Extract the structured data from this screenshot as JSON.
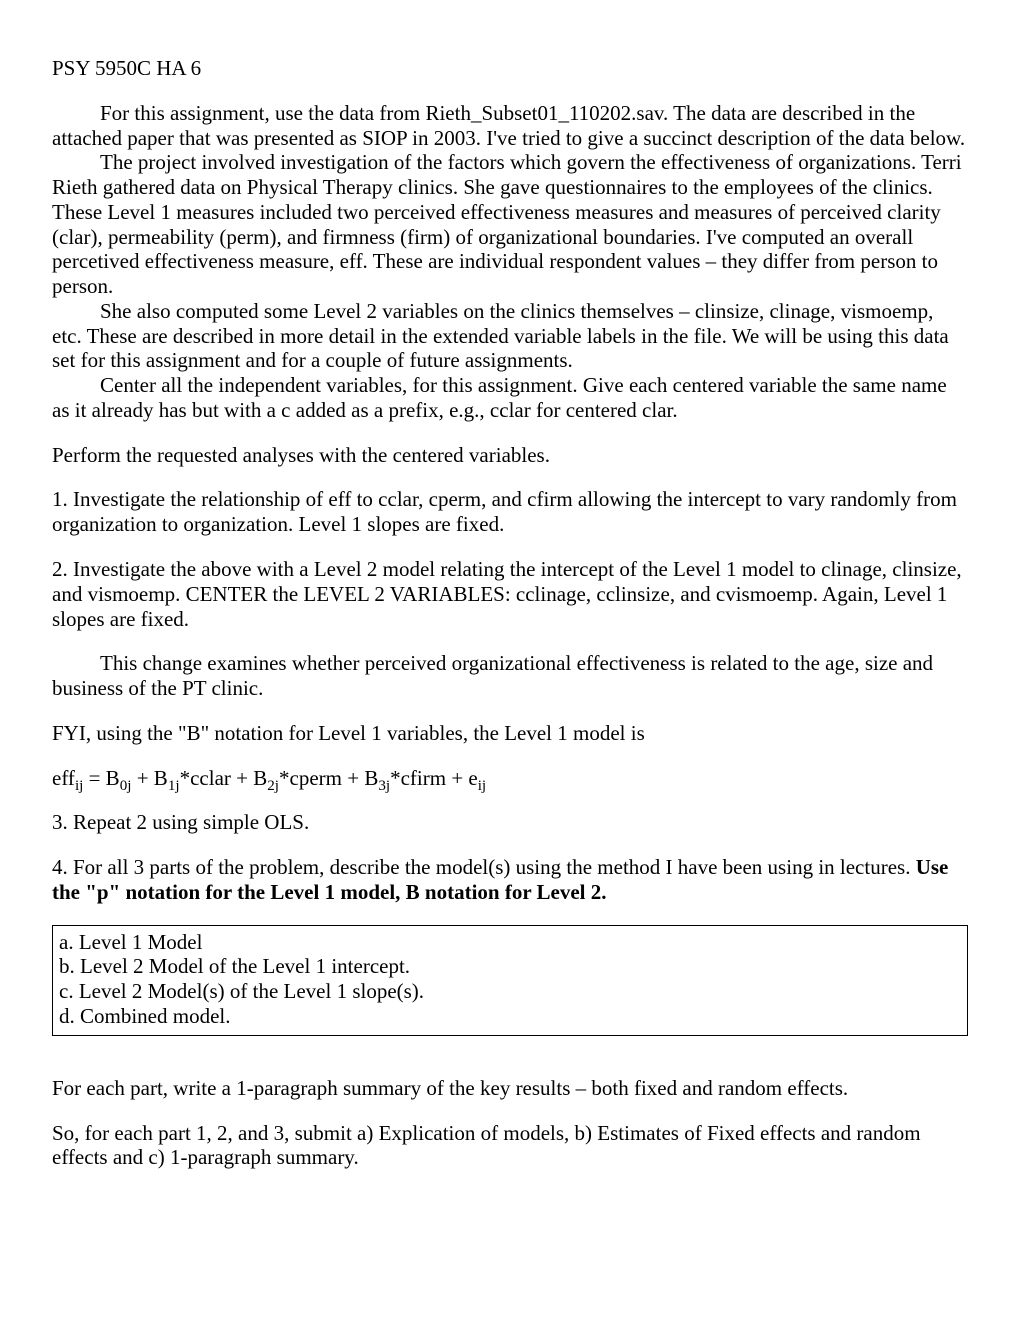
{
  "header": "PSY 5950C HA 6",
  "p1": "For this assignment, use the data from Rieth_Subset01_110202.sav.  The data are described in the attached paper that was presented as SIOP in 2003.  I've tried to give a succinct description of the data below.",
  "p2": "The project involved investigation of the factors which govern the effectiveness of organizations.  Terri Rieth gathered data on Physical Therapy clinics.  She gave questionnaires to the employees of the clinics.  These Level 1 measures included two perceived effectiveness measures and measures of perceived clarity (clar), permeability (perm), and firmness (firm) of organizational boundaries.  I've computed an overall percetived effectiveness measure, eff.  These are individual respondent values – they differ from person to person.",
  "p3": "She also computed some Level 2 variables on the clinics themselves – clinsize, clinage, vismoemp, etc.  These are described in more detail in the extended variable labels in the file.  We will be using this data set for this assignment and for a couple of future assignments.",
  "p4": "Center all the independent variables, for this assignment.   Give each centered variable the same name as it already has but with a c added as a prefix, e.g., cclar for centered clar.",
  "p5": "Perform the requested analyses with the centered variables.",
  "q1": "1.  Investigate the relationship of eff to cclar, cperm, and cfirm allowing the intercept to vary randomly from organization to organization.    Level 1 slopes are fixed.",
  "q2": "2.  Investigate the above with a Level 2 model relating the intercept of the Level 1 model to clinage, clinsize, and vismoemp.  CENTER the LEVEL 2 VARIABLES:  cclinage, cclinsize, and cvismoemp.  Again, Level 1 slopes are fixed.",
  "q2b": "This change examines whether perceived organizational effectiveness is related to the age, size and business of the PT clinic.",
  "fyi": "FYI, using the \"B\" notation for Level 1 variables, the  Level 1 model is",
  "formula": {
    "eff": "eff",
    "ij1": "ij",
    "eq": " = B",
    "s0j": "0j",
    "plus1": " + B",
    "s1j": "1j",
    "t1": "*cclar + B",
    "s2j": "2j",
    "t2": "*cperm + B",
    "s3j": "3j",
    "t3": "*cfirm + e",
    "ij2": "ij"
  },
  "q3": "3.  Repeat 2 using simple OLS.",
  "q4a": "4.  For all 3 parts of the problem, describe the model(s) using the method I have been using in lectures.  ",
  "q4b": "Use the \"p\" notation for the Level 1 model, B notation for Level 2.",
  "box": {
    "a": "a.  Level 1 Model",
    "b": "b.  Level 2 Model of the Level 1 intercept.",
    "c": "c.  Level 2 Model(s) of the Level 1 slope(s).",
    "d": "d.  Combined model."
  },
  "summary1": "For each part, write a 1-paragraph summary of the key results – both fixed and random effects.",
  "summary2": "So, for each part 1, 2, and 3, submit  a) Explication of models, b) Estimates of Fixed effects and random effects and c) 1-paragraph summary."
}
